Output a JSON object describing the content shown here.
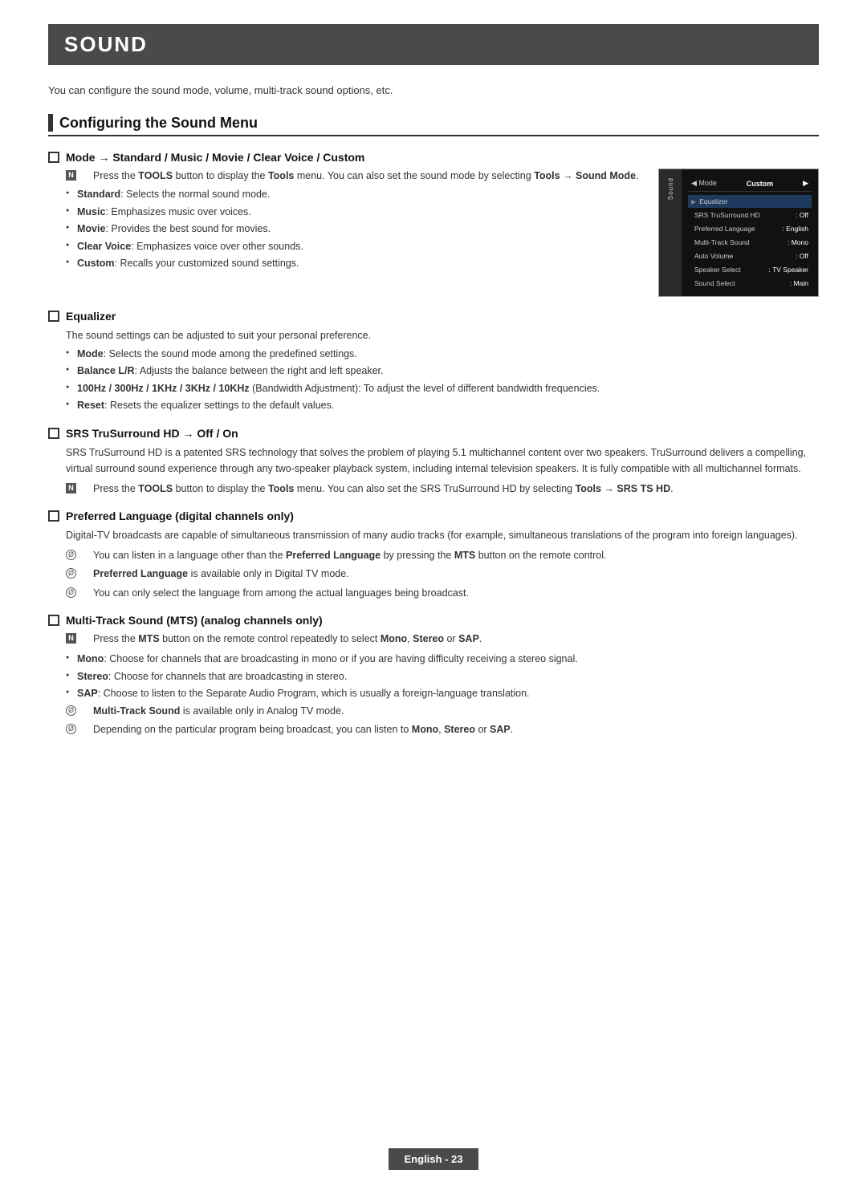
{
  "page": {
    "title": "SOUND",
    "intro": "You can configure the sound mode, volume, multi-track sound options, etc.",
    "footer": "English - 23"
  },
  "section": {
    "title": "Configuring the Sound Menu"
  },
  "subsections": [
    {
      "id": "mode",
      "title": "Mode → Standard / Music / Movie / Clear Voice / Custom",
      "notes": [
        {
          "type": "square",
          "text": "Press the TOOLS button to display the Tools menu. You can also set the sound mode by selecting Tools → Sound Mode."
        }
      ],
      "bullets": [
        {
          "text": "Standard: Selects the normal sound mode."
        },
        {
          "text": "Music: Emphasizes music over voices."
        },
        {
          "text": "Movie: Provides the best sound for movies."
        },
        {
          "text": "Clear Voice: Emphasizes voice over other sounds."
        },
        {
          "text": "Custom: Recalls your customized sound settings."
        }
      ]
    },
    {
      "id": "equalizer",
      "title": "Equalizer",
      "intro": "The sound settings can be adjusted to suit your personal preference.",
      "bullets": [
        {
          "text": "Mode: Selects the sound mode among the predefined settings."
        },
        {
          "text": "Balance L/R: Adjusts the balance between the right and left speaker."
        },
        {
          "text": "100Hz / 300Hz / 1KHz / 3KHz / 10KHz (Bandwidth Adjustment): To adjust the level of different bandwidth frequencies."
        },
        {
          "text": "Reset: Resets the equalizer settings to the default values."
        }
      ]
    },
    {
      "id": "srs",
      "title": "SRS TruSurround HD → Off / On",
      "intro": "SRS TruSurround HD is a patented SRS technology that solves the problem of playing 5.1 multichannel content over two speakers. TruSurround delivers a compelling, virtual surround sound experience through any two-speaker playback system, including internal television speakers. It is fully compatible with all multichannel formats.",
      "notes": [
        {
          "type": "square",
          "text": "Press the TOOLS button to display the Tools menu. You can also set the SRS TruSurround HD by selecting Tools → SRS TS HD."
        }
      ]
    },
    {
      "id": "preferred-language",
      "title": "Preferred Language (digital channels only)",
      "intro": "Digital-TV broadcasts are capable of simultaneous transmission of many audio tracks (for example, simultaneous translations of the program into foreign languages).",
      "circle_notes": [
        {
          "text": "You can listen in a language other than the Preferred Language by pressing the MTS button on the remote control."
        },
        {
          "text": "Preferred Language is available only in Digital TV mode."
        },
        {
          "text": "You can only select the language from among the actual languages being broadcast."
        }
      ]
    },
    {
      "id": "multi-track",
      "title": "Multi-Track Sound (MTS) (analog channels only)",
      "square_note": "Press the MTS button on the remote control repeatedly to select Mono, Stereo or SAP.",
      "bullets": [
        {
          "text": "Mono: Choose for channels that are broadcasting in mono or if you are having difficulty receiving a stereo signal."
        },
        {
          "text": "Stereo: Choose for channels that are broadcasting in stereo."
        },
        {
          "text": "SAP: Choose to listen to the Separate Audio Program, which is usually a foreign-language translation."
        }
      ],
      "circle_notes": [
        {
          "text": "Multi-Track Sound is available only in Analog TV mode."
        },
        {
          "text": "Depending on the particular program being broadcast, you can listen to Mono, Stereo or SAP."
        }
      ]
    }
  ],
  "tv_menu": {
    "sidebar_label": "Sound",
    "mode_label": "Mode",
    "mode_value": "Custom",
    "rows": [
      {
        "icon": "▶",
        "label": "Equalizer",
        "value": "",
        "highlighted": false
      },
      {
        "icon": "",
        "label": "SRS TruSurround HD",
        "value": ": Off",
        "highlighted": false
      },
      {
        "icon": "",
        "label": "Preferred Language",
        "value": ": English",
        "highlighted": false
      },
      {
        "icon": "",
        "label": "Multi-Track Sound",
        "value": ": Mono",
        "highlighted": false
      },
      {
        "icon": "",
        "label": "Auto Volume",
        "value": ": Off",
        "highlighted": false
      },
      {
        "icon": "",
        "label": "Speaker Select",
        "value": ": TV Speaker",
        "highlighted": false
      },
      {
        "icon": "",
        "label": "Sound Select",
        "value": ": Main",
        "highlighted": false
      }
    ]
  }
}
